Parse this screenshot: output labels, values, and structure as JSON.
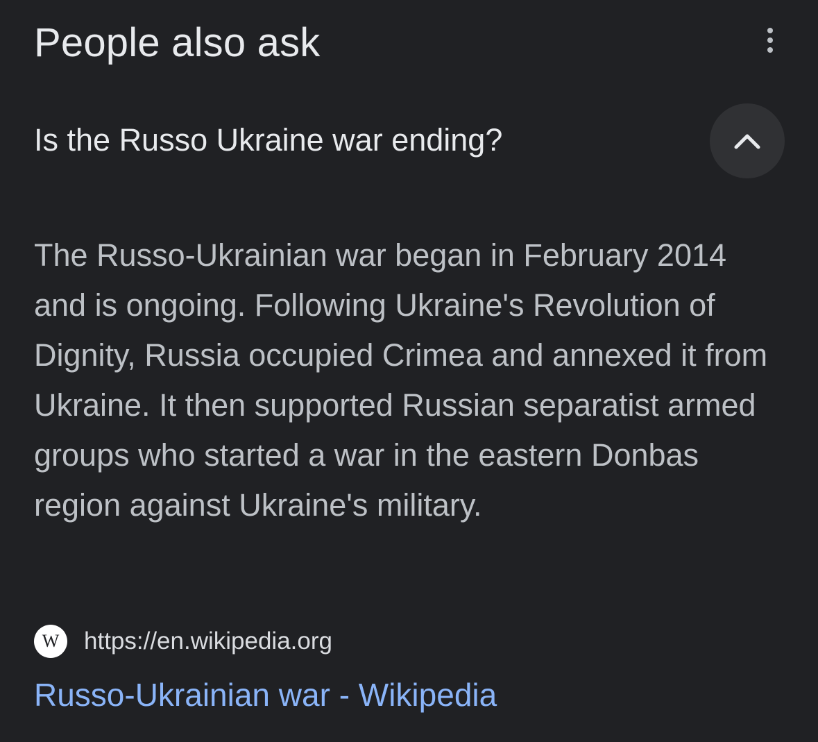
{
  "section": {
    "title": "People also ask",
    "more_icon": "more-vertical-icon"
  },
  "question": {
    "text": "Is the Russo Ukraine war ending?",
    "toggle_icon": "chevron-up-icon",
    "expanded": true
  },
  "answer": {
    "text": "The Russo-Ukrainian war began in February 2014 and is ongoing. Following Ukraine's Revolution of Dignity, Russia occupied Crimea and annexed it from Ukraine. It then supported Russian separatist armed groups who started a war in the eastern Donbas region against Ukraine's military."
  },
  "source": {
    "favicon_letter": "W",
    "favicon_icon": "wikipedia-icon",
    "url": "https://en.wikipedia.org",
    "title": "Russo-Ukrainian war - Wikipedia"
  },
  "colors": {
    "background": "#202124",
    "primary_text": "#e8eaed",
    "secondary_text": "#bdc1c6",
    "link": "#8ab4f8",
    "button_background": "#303134"
  }
}
